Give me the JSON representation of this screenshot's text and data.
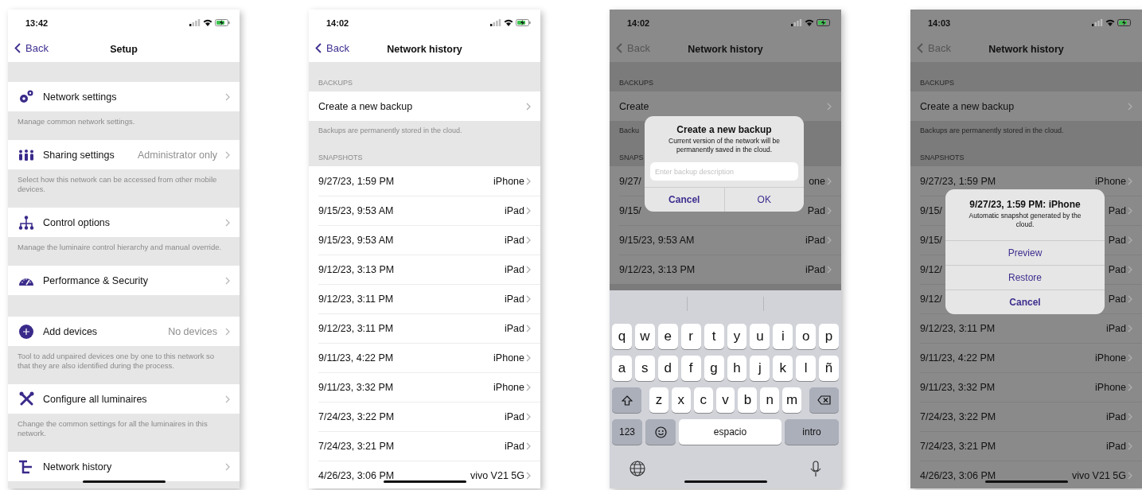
{
  "phones": [
    {
      "kind": "setup",
      "time": "13:42",
      "back": "Back",
      "title": "Setup",
      "dimmed": false,
      "items": [
        {
          "label": "Network settings",
          "description": "Manage common network settings."
        },
        {
          "label": "Sharing settings",
          "value": "Administrator only",
          "description": "Select how this network can be accessed from other mobile devices."
        },
        {
          "label": "Control options",
          "description": "Manage the luminaire control hierarchy and manual override."
        },
        {
          "label": "Performance & Security"
        },
        {
          "label": "Add devices",
          "value": "No devices",
          "description": "Tool to add unpaired devices one by one to this network so that they are also identified during the process."
        },
        {
          "label": "Configure all luminaires",
          "description": "Change the common settings for all the luminaires in this network."
        },
        {
          "label": "Network history"
        }
      ]
    },
    {
      "kind": "history",
      "time": "14:02",
      "back": "Back",
      "title": "Network history",
      "dimmed": false,
      "sections": [
        {
          "header": "BACKUPS",
          "rows": [
            {
              "left": "Create a new backup"
            }
          ],
          "footer": "Backups are permanently stored in the cloud."
        },
        {
          "header": "SNAPSHOTS",
          "rows": [
            {
              "left": "9/27/23, 1:59 PM",
              "right": "iPhone"
            },
            {
              "left": "9/15/23, 9:53 AM",
              "right": "iPad"
            },
            {
              "left": "9/15/23, 9:53 AM",
              "right": "iPad"
            },
            {
              "left": "9/12/23, 3:13 PM",
              "right": "iPad"
            },
            {
              "left": "9/12/23, 3:11 PM",
              "right": "iPad"
            },
            {
              "left": "9/12/23, 3:11 PM",
              "right": "iPad"
            },
            {
              "left": "9/11/23, 4:22 PM",
              "right": "iPhone"
            },
            {
              "left": "9/11/23, 3:32 PM",
              "right": "iPhone"
            },
            {
              "left": "7/24/23, 3:22 PM",
              "right": "iPad"
            },
            {
              "left": "7/24/23, 3:21 PM",
              "right": "iPad"
            },
            {
              "left": "4/26/23, 3:06 PM",
              "right": "vivo V21 5G"
            }
          ]
        }
      ]
    },
    {
      "kind": "history",
      "time": "14:02",
      "back": "Back",
      "title": "Network history",
      "dimmed": true,
      "sections": [
        {
          "header": "BACKUPS",
          "rows": [
            {
              "left": "Create"
            }
          ],
          "footer": "Backu"
        },
        {
          "header": "SNAPS",
          "rows": [
            {
              "left": "9/27/",
              "right": "one"
            },
            {
              "left": "9/15/",
              "right": "Pad"
            },
            {
              "left": "9/15/23, 9:53 AM",
              "right": "iPad"
            },
            {
              "left": "9/12/23, 3:13 PM",
              "right": "iPad"
            }
          ]
        }
      ],
      "dialog": {
        "kind": "input",
        "title": "Create a new backup",
        "message": "Current version of the network will be permanently saved in the cloud.",
        "placeholder": "Enter backup description",
        "buttons": [
          {
            "label": "Cancel",
            "bold": true
          },
          {
            "label": "OK",
            "bold": false
          }
        ]
      },
      "keyboard": {
        "rows": [
          {
            "keys": [
              {
                "kind": "letter",
                "label": "q"
              },
              {
                "kind": "letter",
                "label": "w"
              },
              {
                "kind": "letter",
                "label": "e"
              },
              {
                "kind": "letter",
                "label": "r"
              },
              {
                "kind": "letter",
                "label": "t"
              },
              {
                "kind": "letter",
                "label": "y"
              },
              {
                "kind": "letter",
                "label": "u"
              },
              {
                "kind": "letter",
                "label": "i"
              },
              {
                "kind": "letter",
                "label": "o"
              },
              {
                "kind": "letter",
                "label": "p"
              }
            ]
          },
          {
            "keys": [
              {
                "kind": "letter",
                "label": "a"
              },
              {
                "kind": "letter",
                "label": "s"
              },
              {
                "kind": "letter",
                "label": "d"
              },
              {
                "kind": "letter",
                "label": "f"
              },
              {
                "kind": "letter",
                "label": "g"
              },
              {
                "kind": "letter",
                "label": "h"
              },
              {
                "kind": "letter",
                "label": "j"
              },
              {
                "kind": "letter",
                "label": "k"
              },
              {
                "kind": "letter",
                "label": "l"
              },
              {
                "kind": "letter",
                "label": "ñ"
              }
            ]
          },
          {
            "keys": [
              {
                "kind": "shift"
              },
              {
                "kind": "letter",
                "label": "z"
              },
              {
                "kind": "letter",
                "label": "x"
              },
              {
                "kind": "letter",
                "label": "c"
              },
              {
                "kind": "letter",
                "label": "v"
              },
              {
                "kind": "letter",
                "label": "b"
              },
              {
                "kind": "letter",
                "label": "n"
              },
              {
                "kind": "letter",
                "label": "m"
              },
              {
                "kind": "backspace"
              }
            ]
          },
          {
            "keys": [
              {
                "kind": "mode",
                "label": "123"
              },
              {
                "kind": "emoji"
              },
              {
                "kind": "space",
                "label": "espacio"
              },
              {
                "kind": "return",
                "label": "intro"
              }
            ]
          }
        ]
      }
    },
    {
      "kind": "history",
      "time": "14:03",
      "back": "Back",
      "title": "Network history",
      "dimmed": true,
      "sections": [
        {
          "header": "BACKUPS",
          "rows": [
            {
              "left": "Create a new backup"
            }
          ],
          "footer": "Backups are permanently stored in the cloud."
        },
        {
          "header": "SNAPSHOTS",
          "rows": [
            {
              "left": "9/27/23, 1:59 PM",
              "right": "iPhone"
            },
            {
              "left": "9/15/",
              "right": "Pad"
            },
            {
              "left": "9/15/",
              "right": "Pad"
            },
            {
              "left": "9/12/",
              "right": "Pad"
            },
            {
              "left": "9/12/",
              "right": "Pad"
            },
            {
              "left": "9/12/23, 3:11 PM",
              "right": "iPad"
            },
            {
              "left": "9/11/23, 4:22 PM",
              "right": "iPhone"
            },
            {
              "left": "9/11/23, 3:32 PM",
              "right": "iPhone"
            },
            {
              "left": "7/24/23, 3:22 PM",
              "right": "iPad"
            },
            {
              "left": "7/24/23, 3:21 PM",
              "right": "iPad"
            },
            {
              "left": "4/26/23, 3:06 PM",
              "right": "vivo V21 5G"
            }
          ]
        }
      ],
      "dialog": {
        "kind": "actions",
        "title": "9/27/23, 1:59 PM: iPhone",
        "message": "Automatic snapshot generated by the cloud.",
        "buttons": [
          {
            "label": "Preview",
            "bold": false
          },
          {
            "label": "Restore",
            "bold": false
          },
          {
            "label": "Cancel",
            "bold": true
          }
        ]
      }
    }
  ]
}
